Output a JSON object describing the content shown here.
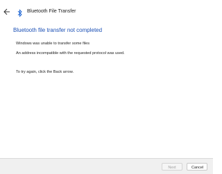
{
  "window": {
    "title": "Bluetooth File Transfer",
    "icons": {
      "back": "back-arrow-icon",
      "app": "bluetooth-icon"
    },
    "accent": "#1a4fb5"
  },
  "content": {
    "heading": "Bluetooth file transfer not completed",
    "line1": "Windows was unable to transfer some files",
    "line2": "An address incompatible with the requested protocol was used.",
    "line3": "To try again, click the Back arrow."
  },
  "footer": {
    "next_label": "Next",
    "cancel_label": "Cancel"
  }
}
